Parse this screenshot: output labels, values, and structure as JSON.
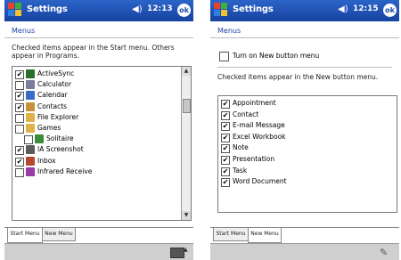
{
  "left": {
    "title": "Settings",
    "clock": "12:13",
    "ok": "ok",
    "heading": "Menus",
    "description": "Checked items appear in the Start menu. Others appear in Programs.",
    "items": [
      {
        "label": "ActiveSync",
        "checked": true,
        "indent": 0,
        "icon_color": "#2d6d2d"
      },
      {
        "label": "Calculator",
        "checked": false,
        "indent": 0,
        "icon_color": "#7c7c9c"
      },
      {
        "label": "Calendar",
        "checked": true,
        "indent": 0,
        "icon_color": "#3a6bc8"
      },
      {
        "label": "Contacts",
        "checked": true,
        "indent": 0,
        "icon_color": "#c8903a"
      },
      {
        "label": "File Explorer",
        "checked": false,
        "indent": 0,
        "icon_color": "#e0b24a"
      },
      {
        "label": "Games",
        "checked": false,
        "indent": 0,
        "icon_color": "#e0b24a"
      },
      {
        "label": "Solitaire",
        "checked": false,
        "indent": 1,
        "icon_color": "#3a8c3a"
      },
      {
        "label": "IA Screenshot",
        "checked": true,
        "indent": 0,
        "icon_color": "#5a5a5a"
      },
      {
        "label": "Inbox",
        "checked": true,
        "indent": 0,
        "icon_color": "#b5482e"
      },
      {
        "label": "Infrared Receive",
        "checked": false,
        "indent": 0,
        "icon_color": "#9a3aa8"
      }
    ],
    "tabs": [
      "Start Menu",
      "New Menu"
    ],
    "active_tab": 0
  },
  "right": {
    "title": "Settings",
    "clock": "12:15",
    "ok": "ok",
    "heading": "Menus",
    "turn_on_label": "Turn on New button menu",
    "turn_on_checked": false,
    "description": "Checked items appear in the New button menu.",
    "items": [
      {
        "label": "Appointment",
        "checked": true
      },
      {
        "label": "Contact",
        "checked": true
      },
      {
        "label": "E-mail Message",
        "checked": true
      },
      {
        "label": "Excel Workbook",
        "checked": true
      },
      {
        "label": "Note",
        "checked": true
      },
      {
        "label": "Presentation",
        "checked": true
      },
      {
        "label": "Task",
        "checked": true
      },
      {
        "label": "Word Document",
        "checked": true
      }
    ],
    "tabs": [
      "Start Menu",
      "New Menu"
    ],
    "active_tab": 1
  },
  "colors": {
    "titlebar": "#1b4aa8",
    "heading": "#1c44a8",
    "checkmark": "#000000"
  }
}
